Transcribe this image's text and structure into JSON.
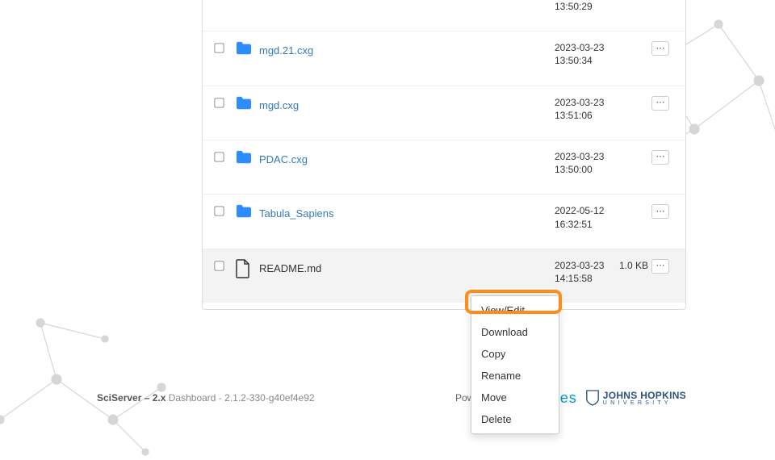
{
  "rows": [
    {
      "name": "",
      "date": "13:50:29",
      "size": "",
      "is_folder": true,
      "first": true
    },
    {
      "name": "mgd.21.cxg",
      "date": "2023-03-23\n13:50:34",
      "size": "",
      "is_folder": true
    },
    {
      "name": "mgd.cxg",
      "date": "2023-03-23\n13:51:06",
      "size": "",
      "is_folder": true
    },
    {
      "name": "PDAC.cxg",
      "date": "2023-03-23\n13:50:00",
      "size": "",
      "is_folder": true
    },
    {
      "name": "Tabula_Sapiens",
      "date": "2022-05-12\n16:32:51",
      "size": "",
      "is_folder": true
    },
    {
      "name": "README.md",
      "date": "2023-03-23\n14:15:58",
      "size": "1.0 KB",
      "is_folder": false,
      "highlight": true
    }
  ],
  "download_label": "Download",
  "dropdown": {
    "items": [
      "View/Edit",
      "Download",
      "Copy",
      "Rename",
      "Move",
      "Delete"
    ]
  },
  "footer": {
    "product": "SciServer – 2.x",
    "section": "Dashboard",
    "version": "2.1.2-330-g40ef4e92",
    "powered_by": "Powered by:",
    "idies": "idies",
    "jhu_main": "JOHNS HOPKINS",
    "jhu_sub": "U N I V E R S I T Y"
  }
}
